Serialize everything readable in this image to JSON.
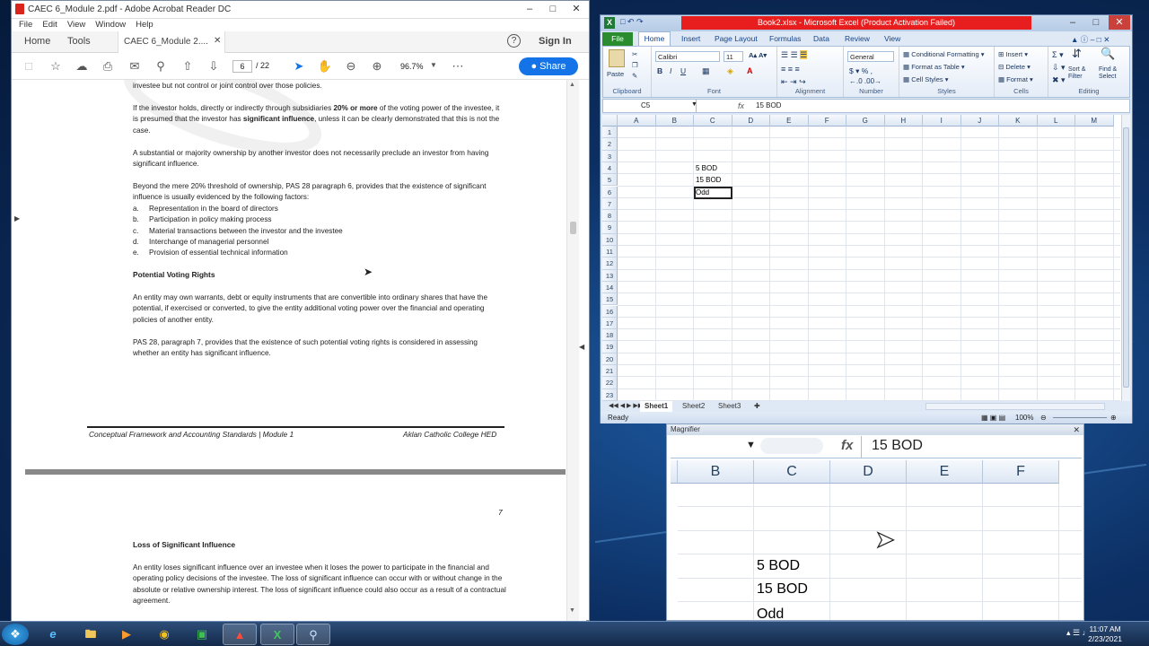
{
  "acrobat": {
    "title": "CAEC 6_Module 2.pdf - Adobe Acrobat Reader DC",
    "menu": [
      "File",
      "Edit",
      "View",
      "Window",
      "Help"
    ],
    "tabs": {
      "home": "Home",
      "tools": "Tools",
      "doc": "CAEC 6_Module 2....",
      "sign_in": "Sign In"
    },
    "toolbar": {
      "page_current": "6",
      "page_total": "/ 22",
      "zoom": "96.7%",
      "share": "Share"
    },
    "page1": {
      "p0": "investee but not control or joint control over those policies.",
      "p1_pre": "If the investor holds, directly or indirectly through subsidiaries ",
      "p1_bold": "20% or more",
      "p1_mid": " of the voting power of the investee, it is presumed that the investor has ",
      "p1_bold2": "significant influence",
      "p1_post": ", unless it can be clearly demonstrated that this is not the case.",
      "p2": "A substantial or majority ownership by another investor does not necessarily preclude an investor from having significant influence.",
      "p3": "Beyond the mere 20% threshold of ownership, PAS 28 paragraph 6, provides that the existence of significant influence is usually evidenced by the following factors:",
      "factors": [
        {
          "k": "a.",
          "t": "Representation in the board of directors"
        },
        {
          "k": "b.",
          "t": "Participation in policy making process"
        },
        {
          "k": "c.",
          "t": "Material transactions between the investor and the investee"
        },
        {
          "k": "d.",
          "t": "Interchange of managerial personnel"
        },
        {
          "k": "e.",
          "t": "Provision of essential technical information"
        }
      ],
      "heading": "Potential Voting Rights",
      "p4": "An entity may own warrants, debt or equity instruments that are convertible into ordinary shares that have the potential, if exercised or converted, to give the entity additional voting power over the financial and operating policies of another entity.",
      "p5": "PAS 28, paragraph 7, provides that the existence of such potential voting rights is considered in assessing whether an entity has significant influence.",
      "footer_left": "Conceptual Framework and Accounting Standards | Module 1",
      "footer_right": "Aklan Catholic College HED"
    },
    "page2": {
      "page_no": "7",
      "heading": "Loss of Significant Influence",
      "p1": "An entity loses significant influence over an investee when it loses the power to participate in the financial and operating policy decisions of the investee. The loss of significant influence can occur with or without change in the absolute or relative ownership interest. The loss of significant influence could also occur as a result of a contractual agreement."
    }
  },
  "excel": {
    "title": "Book2.xlsx - Microsoft Excel (Product Activation Failed)",
    "ribbon_tabs": [
      "File",
      "Home",
      "Insert",
      "Page Layout",
      "Formulas",
      "Data",
      "Review",
      "View"
    ],
    "groups": {
      "clipboard": "Clipboard",
      "font": "Font",
      "alignment": "Alignment",
      "number": "Number",
      "styles": "Styles",
      "cells": "Cells",
      "editing": "Editing"
    },
    "font_name": "Calibri",
    "font_size": "11",
    "number_format": "General",
    "styles_items": [
      "Conditional Formatting",
      "Format as Table",
      "Cell Styles"
    ],
    "cells_items": [
      "Insert",
      "Delete",
      "Format"
    ],
    "editing_items": [
      "Sort & Filter",
      "Find & Select"
    ],
    "paste": "Paste",
    "name_box": "C5",
    "fx": "fx",
    "formula_value": "15 BOD",
    "columns": [
      "A",
      "B",
      "C",
      "D",
      "E",
      "F",
      "G",
      "H",
      "I",
      "J",
      "K",
      "L",
      "M"
    ],
    "rows": [
      "1",
      "2",
      "3",
      "4",
      "5",
      "6",
      "7",
      "8",
      "9",
      "10",
      "11",
      "12",
      "13",
      "14",
      "15",
      "16",
      "17",
      "18",
      "19",
      "20",
      "21",
      "22",
      "23"
    ],
    "cells": [
      {
        "ref": "C4",
        "value": "5 BOD"
      },
      {
        "ref": "C5",
        "value": "15 BOD"
      },
      {
        "ref": "C6",
        "value": "Odd"
      }
    ],
    "sheets": [
      "Sheet1",
      "Sheet2",
      "Sheet3"
    ],
    "status": "Ready",
    "zoom": "100%"
  },
  "magnifier": {
    "title": "Magnifier",
    "fx": "fx",
    "formula_value": "15 BOD",
    "columns": [
      "B",
      "C",
      "D",
      "E",
      "F"
    ],
    "cells": [
      "5 BOD",
      "15 BOD",
      "Odd"
    ]
  },
  "taskbar": {
    "time": "11:07 AM",
    "date": "2/23/2021"
  }
}
